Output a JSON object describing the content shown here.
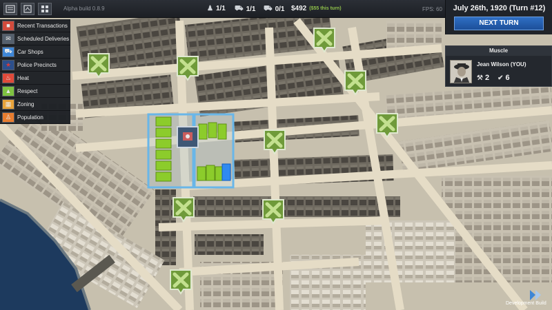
{
  "topbar": {
    "build_label": "Alpha build 0.8.9",
    "stats": [
      {
        "icon": "muscle-icon",
        "value": "1/1"
      },
      {
        "icon": "car-icon",
        "value": "1/1"
      },
      {
        "icon": "truck-icon",
        "value": "0/1"
      }
    ],
    "money": "$492",
    "money_delta": "($55 this turn)",
    "fps": "FPS: 60"
  },
  "date_panel": {
    "date": "July 26th, 1920  (Turn #12)",
    "next_turn_label": "NEXT TURN"
  },
  "character": {
    "header": "Muscle",
    "name": "Jean Wilson (YOU)",
    "stat_a": "2",
    "stat_b": "6"
  },
  "menu": {
    "items": [
      {
        "label": "Recent Transactions",
        "icon": "transactions-icon",
        "color": "#d24b3c"
      },
      {
        "label": "Scheduled Deliveries",
        "icon": "deliveries-icon",
        "color": "#cfd3d8"
      },
      {
        "label": "Car Shops",
        "icon": "car-shop-icon",
        "color": "#3e86d6"
      },
      {
        "label": "Police Precincts",
        "icon": "police-icon",
        "color": "#d83b3b"
      },
      {
        "label": "Heat",
        "icon": "heat-icon",
        "color": "#e04a3a"
      },
      {
        "label": "Respect",
        "icon": "respect-icon",
        "color": "#7fc241"
      },
      {
        "label": "Zoning",
        "icon": "zoning-icon",
        "color": "#e8a33a"
      },
      {
        "label": "Population",
        "icon": "population-icon",
        "color": "#e87d2f"
      }
    ]
  },
  "footer": {
    "dev_build": "Development Build"
  },
  "colors": {
    "accent_blue": "#2f6fc4",
    "territory_green": "#8ccc2b",
    "marker_green": "#6f9a3a",
    "water": "#1f3a5c"
  }
}
